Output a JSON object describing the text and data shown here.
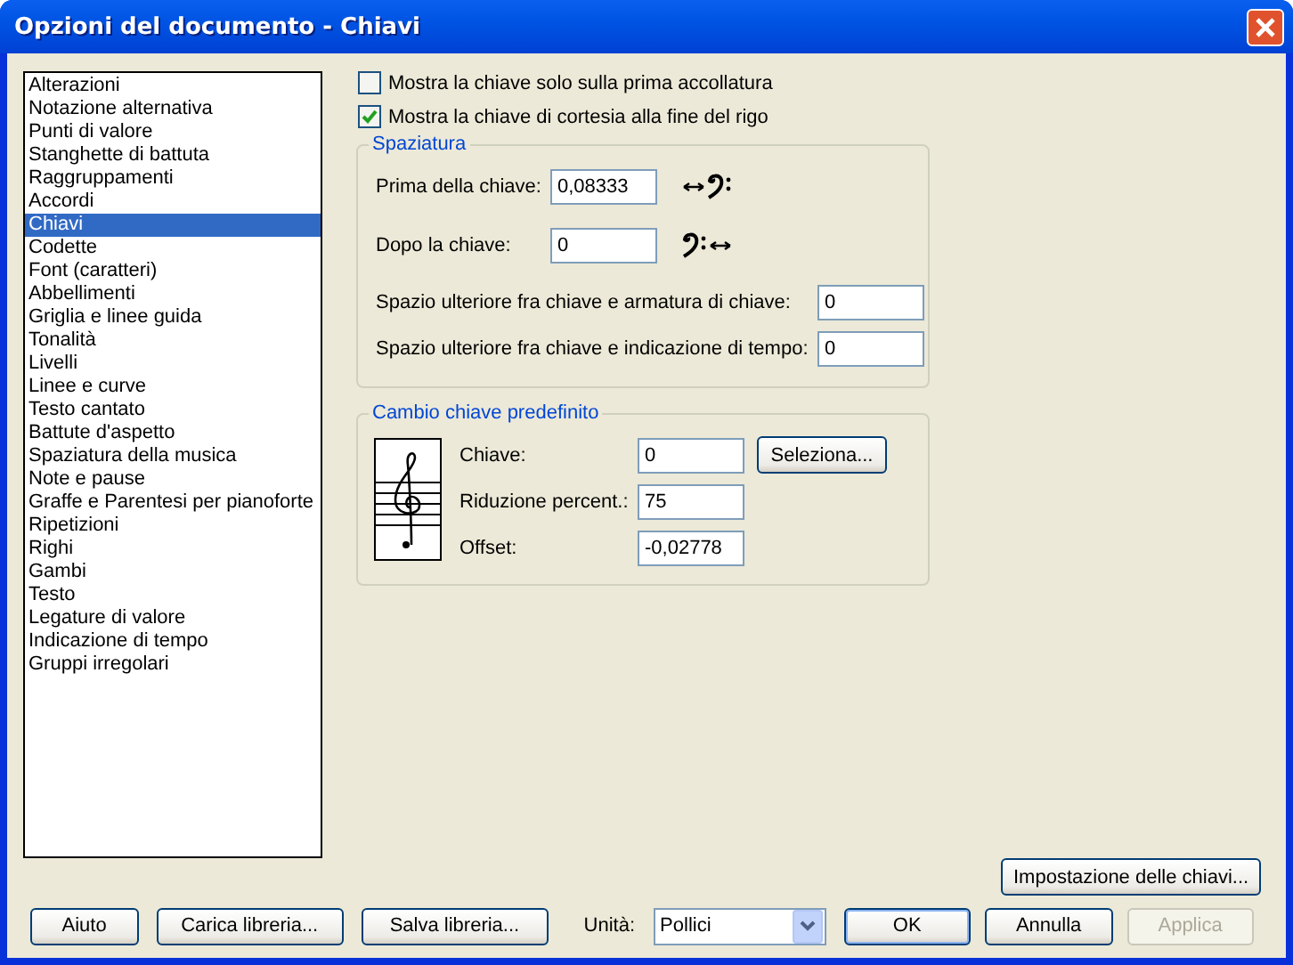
{
  "window": {
    "title": "Opzioni del documento - Chiavi"
  },
  "categories": [
    {
      "label": "Alterazioni",
      "selected": false
    },
    {
      "label": "Notazione alternativa",
      "selected": false
    },
    {
      "label": "Punti di valore",
      "selected": false
    },
    {
      "label": "Stanghette di battuta",
      "selected": false
    },
    {
      "label": "Raggruppamenti",
      "selected": false
    },
    {
      "label": "Accordi",
      "selected": false
    },
    {
      "label": "Chiavi",
      "selected": true
    },
    {
      "label": "Codette",
      "selected": false
    },
    {
      "label": "Font (caratteri)",
      "selected": false
    },
    {
      "label": "Abbellimenti",
      "selected": false
    },
    {
      "label": "Griglia e linee guida",
      "selected": false
    },
    {
      "label": "Tonalità",
      "selected": false
    },
    {
      "label": "Livelli",
      "selected": false
    },
    {
      "label": "Linee e curve",
      "selected": false
    },
    {
      "label": "Testo cantato",
      "selected": false
    },
    {
      "label": "Battute d'aspetto",
      "selected": false
    },
    {
      "label": "Spaziatura della musica",
      "selected": false
    },
    {
      "label": "Note e pause",
      "selected": false
    },
    {
      "label": "Graffe e Parentesi per pianoforte",
      "selected": false
    },
    {
      "label": "Ripetizioni",
      "selected": false
    },
    {
      "label": "Righi",
      "selected": false
    },
    {
      "label": "Gambi",
      "selected": false
    },
    {
      "label": "Testo",
      "selected": false
    },
    {
      "label": "Legature di valore",
      "selected": false
    },
    {
      "label": "Indicazione di tempo",
      "selected": false
    },
    {
      "label": "Gruppi irregolari",
      "selected": false
    }
  ],
  "options": [
    {
      "label": "Mostra la chiave solo sulla prima accollatura",
      "checked": false
    },
    {
      "label": "Mostra la chiave di cortesia alla fine del rigo",
      "checked": true
    }
  ],
  "spacing": {
    "title": "Spaziatura",
    "fields": [
      {
        "kind": "before",
        "label": "Prima della chiave:",
        "value": "0,08333"
      },
      {
        "kind": "after",
        "label": "Dopo la chiave:",
        "value": "0"
      },
      {
        "kind": "wide",
        "label": "Spazio ulteriore fra chiave e armatura di chiave:",
        "value": "0"
      },
      {
        "kind": "wide",
        "label": "Spazio ulteriore fra chiave e indicazione di tempo:",
        "value": "0"
      }
    ]
  },
  "clef_change": {
    "title": "Cambio chiave predefinito",
    "select_button": "Seleziona...",
    "fields": [
      {
        "label": "Chiave:",
        "value": "0"
      },
      {
        "label": "Riduzione percent.:",
        "value": "75"
      },
      {
        "label": "Offset:",
        "value": "-0,02778"
      }
    ]
  },
  "clef_settings_button": "Impostazione delle chiavi...",
  "left_buttons": [
    "Aiuto",
    "Carica libreria...",
    "Salva libreria..."
  ],
  "unit": {
    "label": "Unità:",
    "value": "Pollici"
  },
  "right_buttons": [
    {
      "label": "OK",
      "default": true,
      "disabled": false
    },
    {
      "label": "Annulla",
      "default": false,
      "disabled": false
    },
    {
      "label": "Applica",
      "default": false,
      "disabled": true
    }
  ]
}
